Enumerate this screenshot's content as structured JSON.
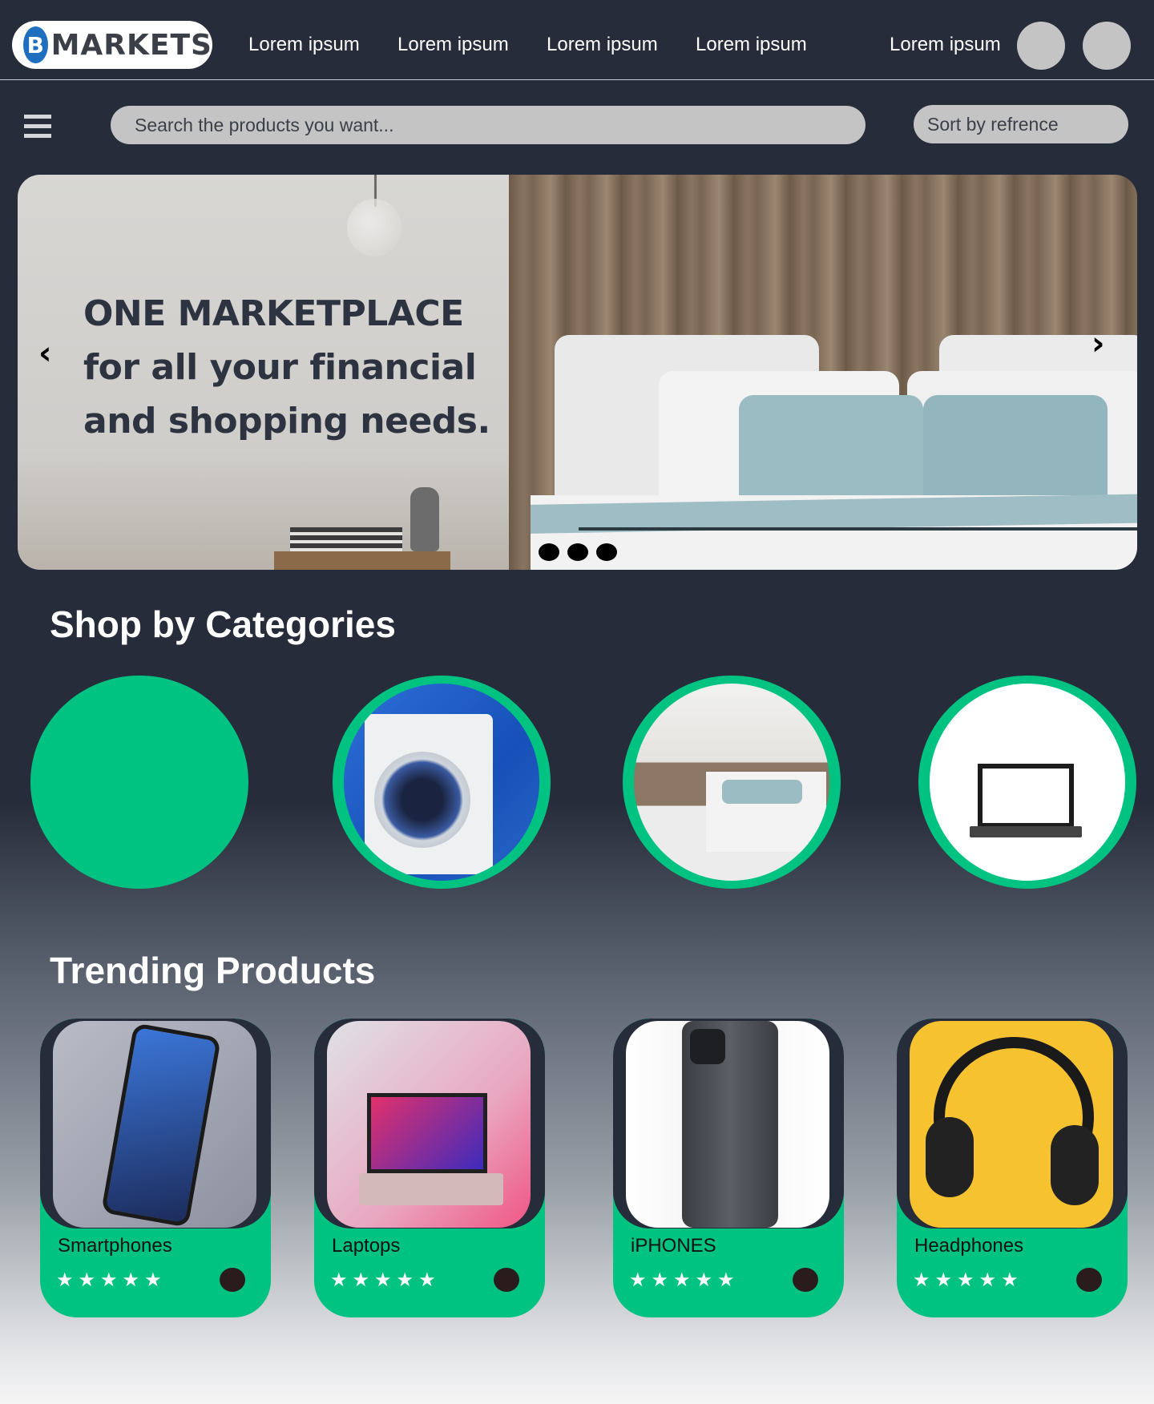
{
  "brand": {
    "logo_letter": "B",
    "logo_text": "MARKETS"
  },
  "nav": {
    "links": [
      "Lorem ipsum",
      "Lorem ipsum",
      "Lorem ipsum",
      "Lorem ipsum",
      "Lorem ipsum"
    ]
  },
  "search": {
    "placeholder": "Search the products you want..."
  },
  "sort": {
    "label": "Sort by refrence"
  },
  "hero": {
    "line1": "ONE MARKETPLACE",
    "line2": "for all your financial",
    "line3": "and shopping needs.",
    "prev_icon": "‹",
    "next_icon": "›"
  },
  "categories": {
    "title": "Shop by Categories"
  },
  "trending": {
    "title": "Trending Products",
    "products": [
      {
        "name": "Smartphones",
        "stars": "★★★★★"
      },
      {
        "name": "Laptops",
        "stars": "★★★★★"
      },
      {
        "name": "iPHONES",
        "stars": "★★★★★"
      },
      {
        "name": "Headphones",
        "stars": "★★★★★"
      }
    ]
  },
  "colors": {
    "accent": "#00c382",
    "background": "#262c3a",
    "pill": "#c4c4c4"
  }
}
